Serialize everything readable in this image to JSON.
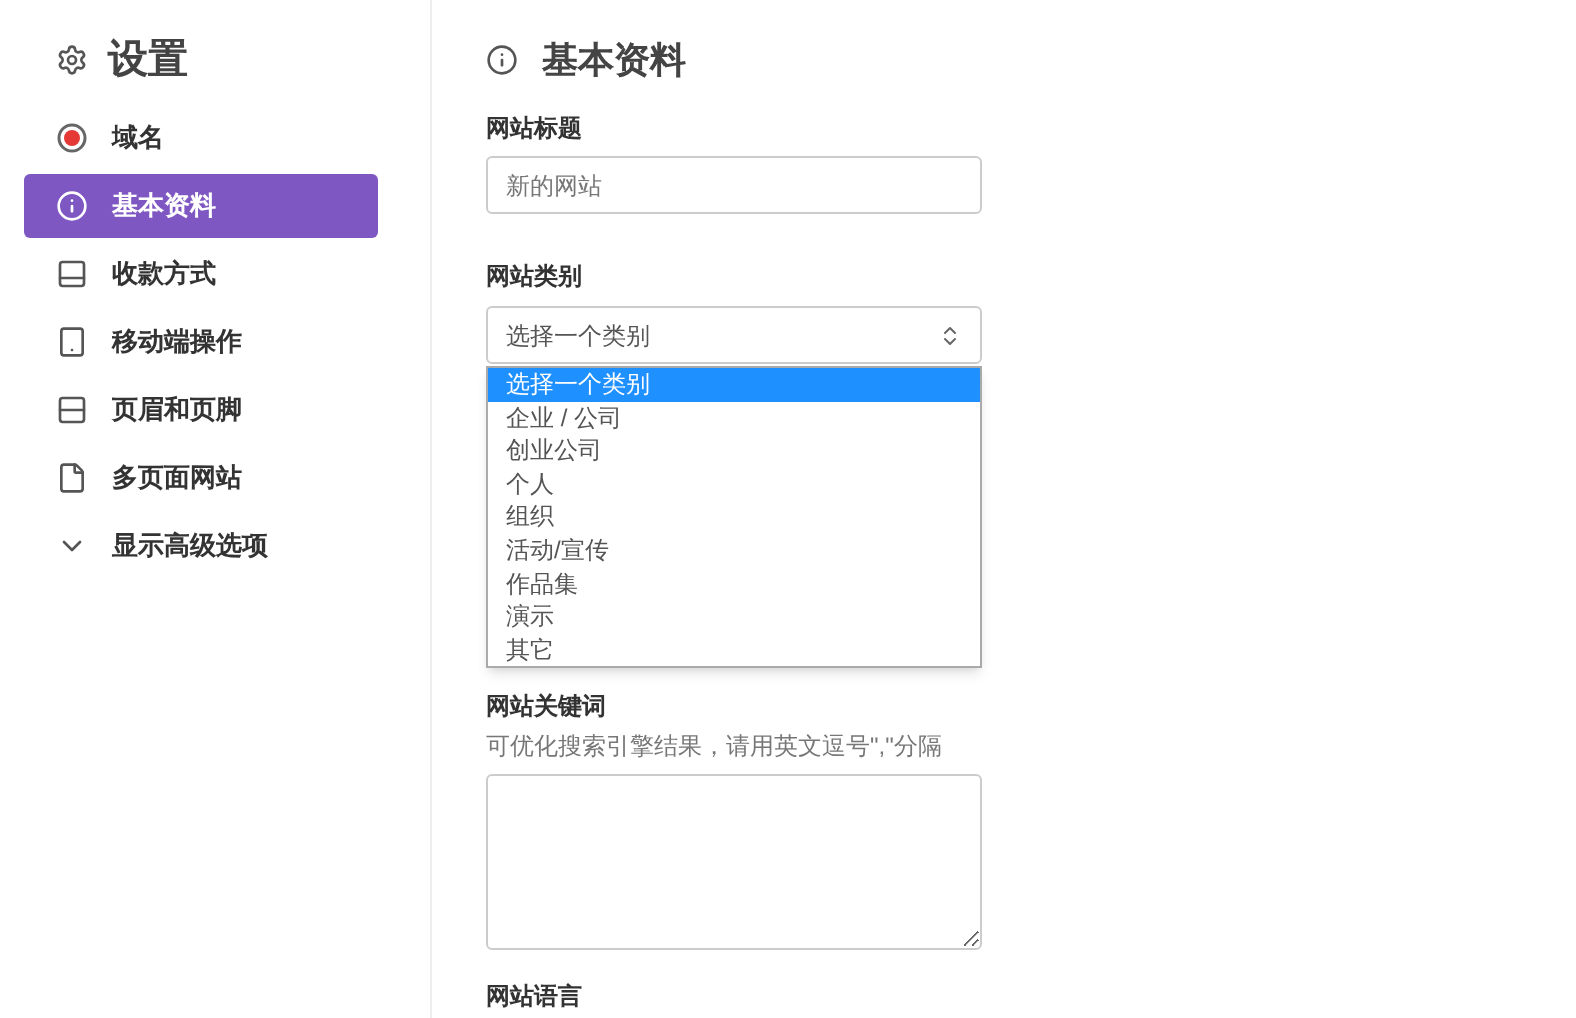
{
  "sidebar": {
    "title": "设置",
    "items": [
      {
        "kind": "domain",
        "label": "域名",
        "selected": false
      },
      {
        "kind": "info",
        "label": "基本资料",
        "selected": true
      },
      {
        "kind": "payment",
        "label": "收款方式",
        "selected": false
      },
      {
        "kind": "mobile",
        "label": "移动端操作",
        "selected": false
      },
      {
        "kind": "header-footer",
        "label": "页眉和页脚",
        "selected": false
      },
      {
        "kind": "pages",
        "label": "多页面网站",
        "selected": false
      },
      {
        "kind": "advanced",
        "label": "显示高级选项",
        "selected": false
      }
    ]
  },
  "main": {
    "heading": "基本资料",
    "site_title": {
      "label": "网站标题",
      "placeholder": "新的网站"
    },
    "site_category": {
      "label": "网站类别",
      "value": "选择一个类别",
      "expanded": true,
      "options": [
        {
          "label": "选择一个类别",
          "selected": true
        },
        {
          "label": "企业 / 公司",
          "selected": false
        },
        {
          "label": "创业公司",
          "selected": false
        },
        {
          "label": "个人",
          "selected": false
        },
        {
          "label": "组织",
          "selected": false
        },
        {
          "label": "活动/宣传",
          "selected": false
        },
        {
          "label": "作品集",
          "selected": false
        },
        {
          "label": "演示",
          "selected": false
        },
        {
          "label": "其它",
          "selected": false
        }
      ]
    },
    "site_keywords": {
      "label": "网站关键词",
      "hint": "可优化搜索引擎结果，请用英文逗号\",\"分隔"
    },
    "site_language": {
      "label": "网站语言"
    }
  }
}
